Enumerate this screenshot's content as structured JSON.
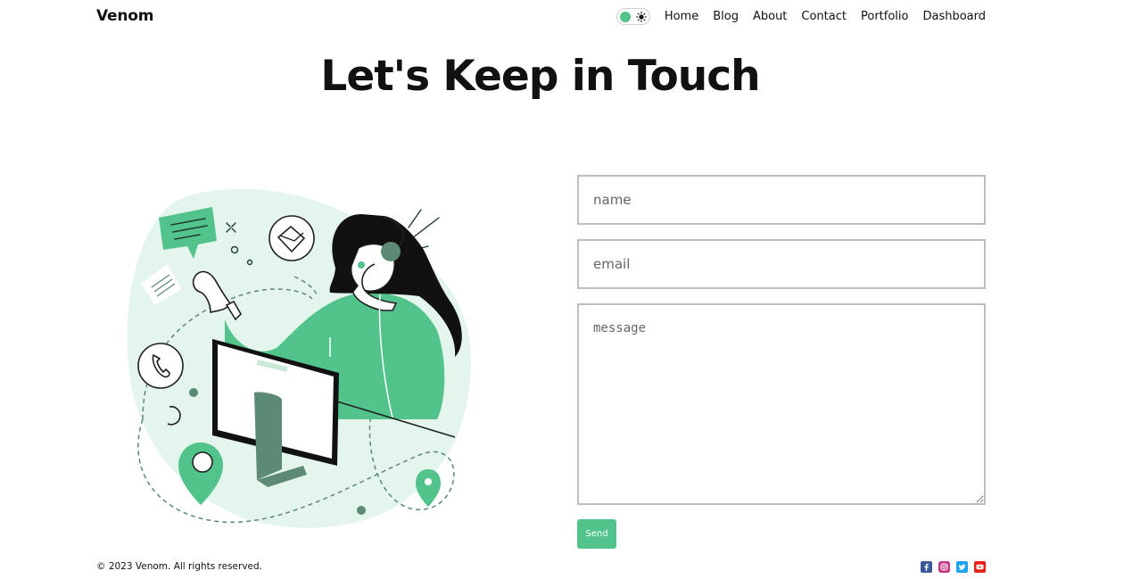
{
  "brand": "Venom",
  "theme_toggle": {
    "state": "light",
    "icon": "sun-icon",
    "accent": "#52c48b"
  },
  "nav": {
    "items": [
      "Home",
      "Blog",
      "About",
      "Contact",
      "Portfolio",
      "Dashboard"
    ]
  },
  "page_title": "Let's Keep in Touch",
  "illustration": {
    "subject": "customer-support-illustration",
    "accent": "#52c48b",
    "blob": "#e3f5ec"
  },
  "form": {
    "name_placeholder": "name",
    "email_placeholder": "email",
    "message_placeholder": "message",
    "send_label": "Send"
  },
  "footer": {
    "copyright": "© 2023 Venom. All rights reserved.",
    "social": [
      {
        "icon": "facebook-icon",
        "color": "#3b5998"
      },
      {
        "icon": "instagram-icon",
        "color": "#c13584"
      },
      {
        "icon": "twitter-icon",
        "color": "#1da1f2"
      },
      {
        "icon": "youtube-icon",
        "color": "#e62117"
      }
    ]
  },
  "colors": {
    "accent": "#52c48b",
    "border": "#bdbdbd",
    "text": "#111111"
  }
}
